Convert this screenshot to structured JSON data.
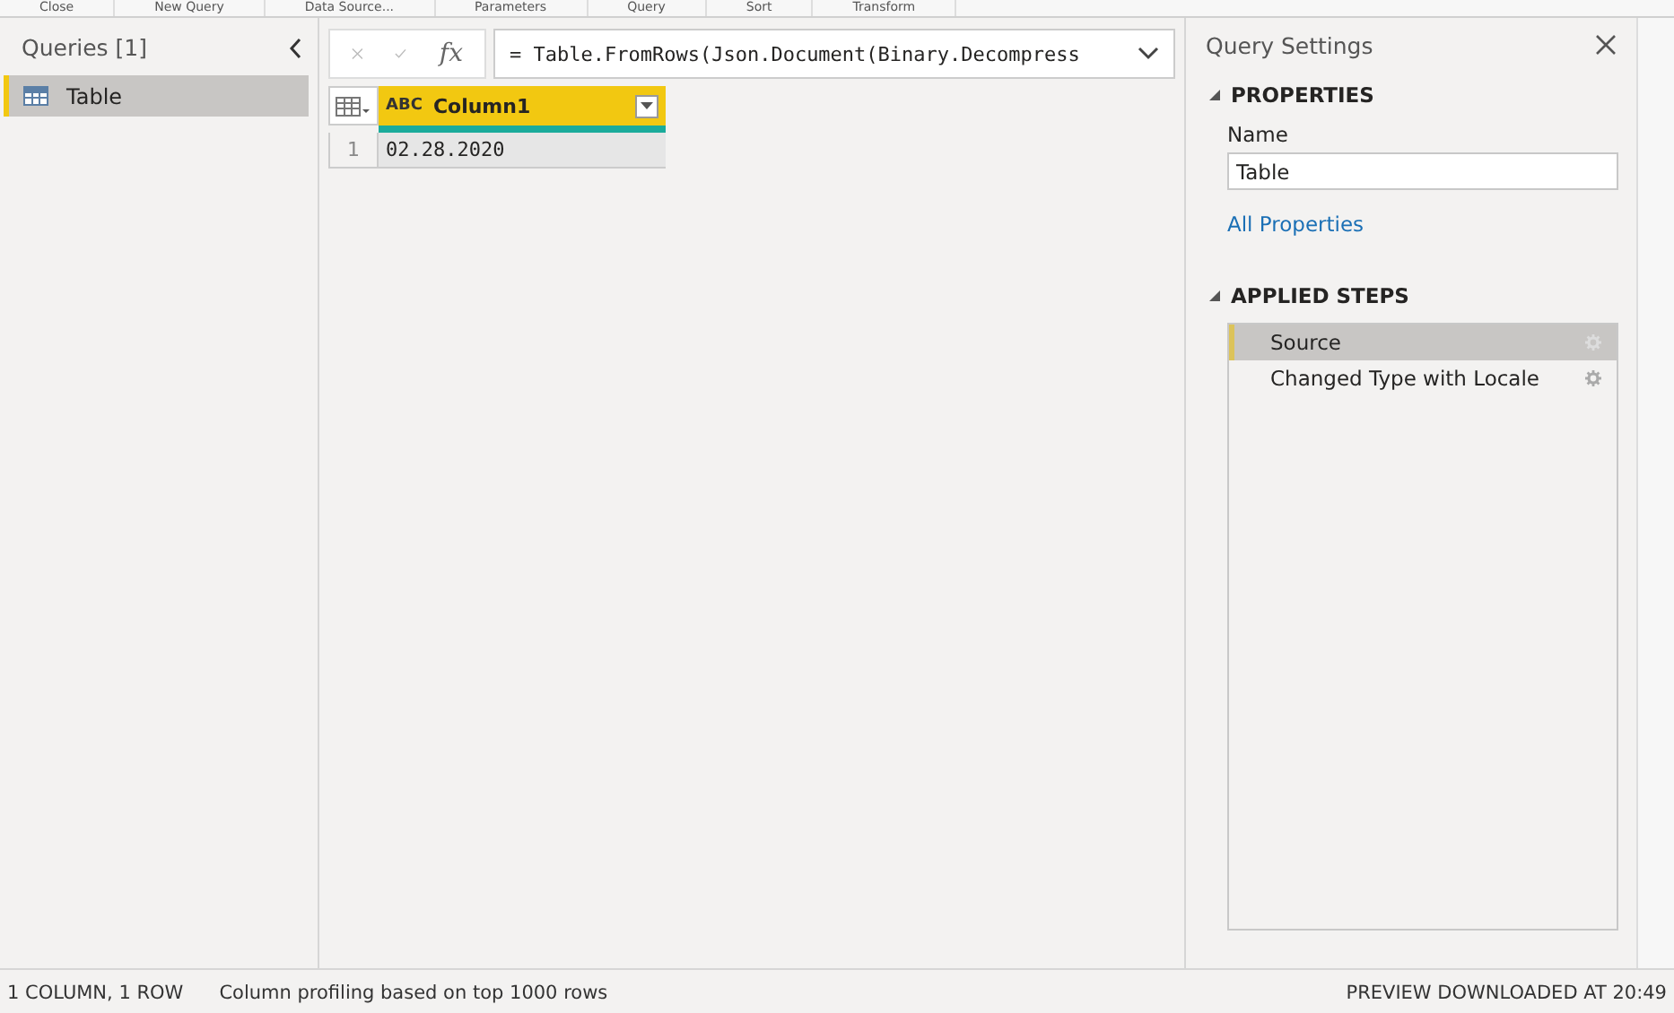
{
  "ribbon": {
    "groups": [
      "Close",
      "New Query",
      "Data Source...",
      "Parameters",
      "Query",
      "Sort",
      "Transform"
    ]
  },
  "queries_pane": {
    "title": "Queries [1]",
    "items": [
      {
        "label": "Table",
        "selected": true
      }
    ]
  },
  "formula_bar": {
    "function_symbol": "fx",
    "formula": "= Table.FromRows(Json.Document(Binary.Decompress"
  },
  "table": {
    "columns": [
      {
        "type_label": "ABC",
        "name": "Column1"
      }
    ],
    "rows": [
      {
        "row_number": "1",
        "cells": [
          "02.28.2020"
        ]
      }
    ]
  },
  "query_settings": {
    "title": "Query Settings",
    "properties_heading": "PROPERTIES",
    "name_label": "Name",
    "name_value": "Table",
    "all_properties_link": "All Properties",
    "steps_heading": "APPLIED STEPS",
    "steps": [
      {
        "label": "Source",
        "selected": true
      },
      {
        "label": "Changed Type with Locale",
        "selected": false
      }
    ]
  },
  "status_bar": {
    "counts": "1 COLUMN, 1 ROW",
    "profiling": "Column profiling based on top 1000 rows",
    "preview": "PREVIEW DOWNLOADED AT 20:49"
  }
}
